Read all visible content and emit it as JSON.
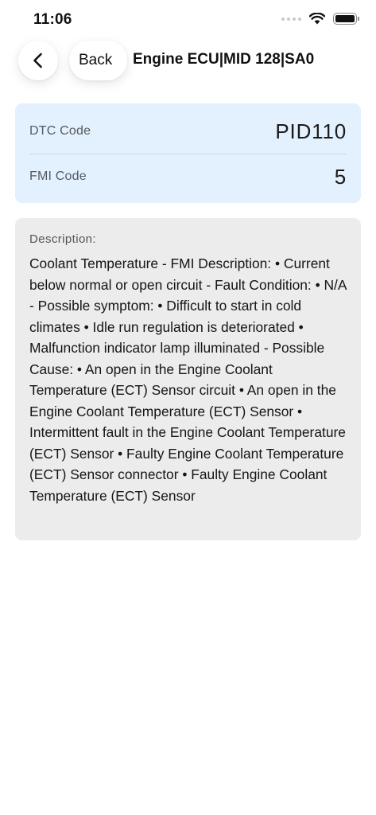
{
  "status_bar": {
    "time": "11:06",
    "icons": [
      "cellular-signal-icon",
      "wifi-icon",
      "battery-icon"
    ]
  },
  "nav": {
    "back_icon": "chevron-left-icon",
    "back_label": "Back",
    "title": "Engine ECU|MID 128|SA0"
  },
  "codes": {
    "dtc_label": "DTC Code",
    "dtc_value": "PID110",
    "fmi_label": "FMI Code",
    "fmi_value": "5"
  },
  "description": {
    "label": "Description:",
    "text": "Coolant Temperature - FMI Description: • Current below normal or open circuit - Fault Condition: • N/A - Possible symptom: • Difficult to start in cold climates • Idle run regulation is deteriorated • Malfunction indicator lamp illuminated - Possible Cause: • An open in the Engine Coolant Temperature (ECT) Sensor circuit • An open in the Engine Coolant Temperature (ECT) Sensor • Intermittent fault in the Engine Coolant Temperature (ECT) Sensor • Faulty Engine Coolant Temperature (ECT) Sensor connector • Faulty Engine Coolant Temperature (ECT) Sensor"
  },
  "colors": {
    "code_card_bg": "#e3f0fd",
    "description_card_bg": "#ececec"
  }
}
